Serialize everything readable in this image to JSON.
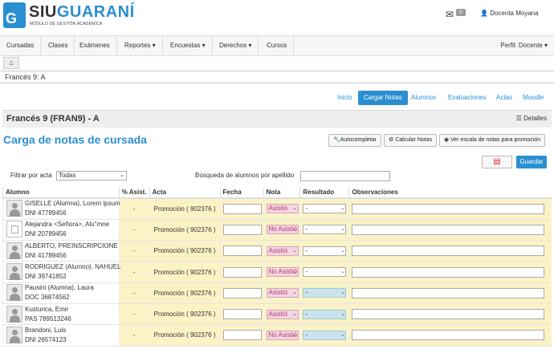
{
  "brand": {
    "part1": "SIU",
    "part2": "GUARANÍ",
    "subtitle": "MÓDULO DE GESTIÓN ACADÉMICA",
    "logo_letter": "G"
  },
  "header": {
    "mail_count": "0",
    "user_name": "Docenta Moyana",
    "mail_icon": "envelope-icon",
    "user_icon": "user-icon"
  },
  "nav": {
    "items": [
      "Cursadas",
      "Clases",
      "Exámenes",
      "Reportes ▾",
      "Encuestas ▾",
      "Derechos ▾",
      "Cursos"
    ],
    "profile": "Perfil: Docente ▾"
  },
  "breadcrumb": "Francés 9: A",
  "tabs": [
    "Inicio",
    "Cargar Notas",
    "Alumnos",
    "Evaluaciones",
    "Actas",
    "Moodle"
  ],
  "subject": {
    "title": "Francés 9 (FRAN9) - A",
    "details": "Detalles"
  },
  "page": {
    "title": "Carga de notas de cursada",
    "btn_autocompletar": "Autocompletar",
    "btn_calcular": "Calcular Notas",
    "btn_escala": "Ver escala de notas para promoción",
    "btn_guardar": "Guardar",
    "filter_label": "Filtrar por acta",
    "filter_value": "Todas",
    "search_label": "Búsqueda de alumnos por apellido"
  },
  "table": {
    "headers": [
      "Alumno",
      "% Asist.",
      "Acta",
      "Fecha",
      "Nota",
      "Resultado",
      "Observaciones"
    ],
    "rows": [
      {
        "name": "GISELLE (Alumna), Lorem ipsum dolor",
        "doc": "DNI 47789456",
        "asist": "-",
        "acta": "Promoción ( 902376 )",
        "nota": "Asistió",
        "resultado": "-"
      },
      {
        "name": "Alejandra <Señora>, Alu\"mne",
        "doc": "DNI 20789456",
        "asist": "-",
        "acta": "Promoción ( 902376 )",
        "nota": "No Asistió",
        "resultado": "-"
      },
      {
        "name": "ALBERTO, PREINSCRIPCIONE",
        "doc": "DNI 41789456",
        "asist": "-",
        "acta": "Promoción ( 902376 )",
        "nota": "Asistió",
        "resultado": "-"
      },
      {
        "name": "RODRIGUEZ (Alumno), NAHUEL",
        "doc": "DNI 39741852",
        "asist": "-",
        "acta": "Promoción ( 902376 )",
        "nota": "No Asistió",
        "resultado": "-"
      },
      {
        "name": "Pausini (Alumna), Laura",
        "doc": "DOC 36874562",
        "asist": "-",
        "acta": "Promoción ( 902376 )",
        "nota": "Asistió",
        "resultado": "-"
      },
      {
        "name": "Kusturica, Emir",
        "doc": "PAS 789513246",
        "asist": "-",
        "acta": "Promoción ( 902376 )",
        "nota": "Asistió",
        "resultado": "-"
      },
      {
        "name": "Brandoni, Luis",
        "doc": "DNI 26574123",
        "asist": "-",
        "acta": "Promoción ( 902376 )",
        "nota": "No Asistió",
        "resultado": "-"
      }
    ]
  },
  "colors": {
    "accent": "#2a8fd0",
    "highlight": "#fbf3c6",
    "nota_bg": "#f2d6e2"
  }
}
